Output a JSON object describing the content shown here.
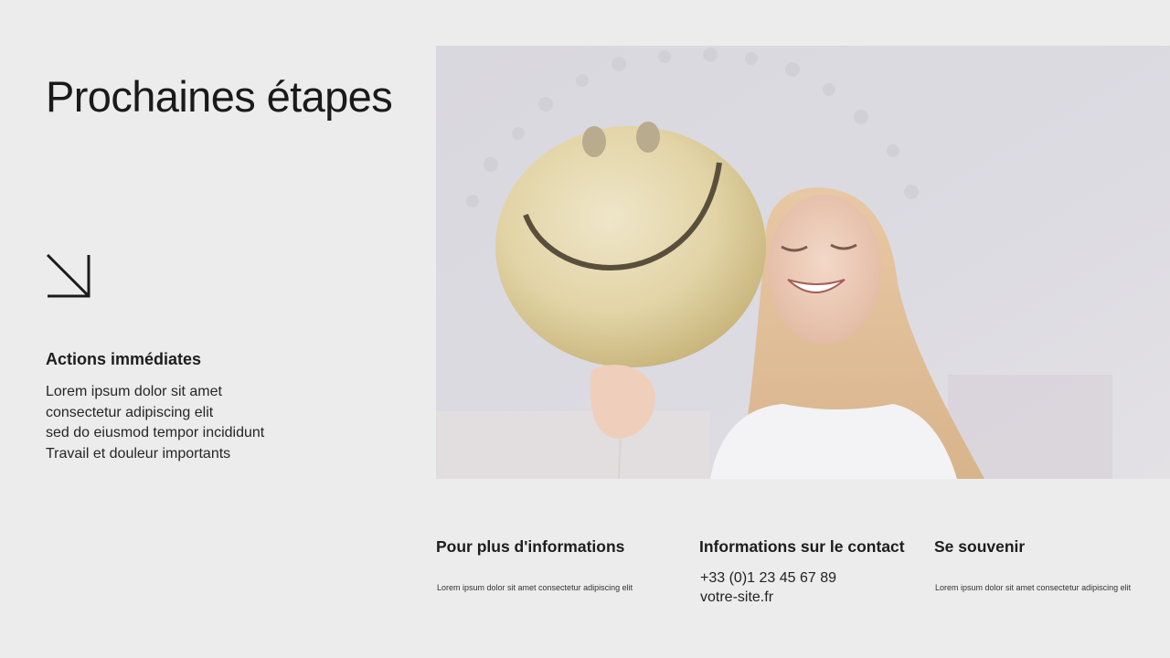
{
  "title": "Prochaines étapes",
  "actions": {
    "heading": "Actions immédiates",
    "lines": [
      "Lorem ipsum dolor sit amet",
      "consectetur adipiscing elit",
      "sed do eiusmod tempor incididunt",
      "Travail et douleur importants"
    ]
  },
  "icons": {
    "arrow": "arrow-down-right-icon"
  },
  "footer": {
    "info": {
      "heading": "Pour plus d'informations",
      "text": "Lorem ipsum dolor sit amet consectetur adipiscing elit"
    },
    "contact": {
      "heading": "Informations sur le contact",
      "phone": "+33 (0)1 23 45 67 89",
      "website": "votre-site.fr"
    },
    "remember": {
      "heading": "Se souvenir",
      "text": "Lorem ipsum dolor sit amet consectetur adipiscing elit"
    }
  },
  "colors": {
    "background": "#ececec",
    "text": "#1b1b1b"
  }
}
